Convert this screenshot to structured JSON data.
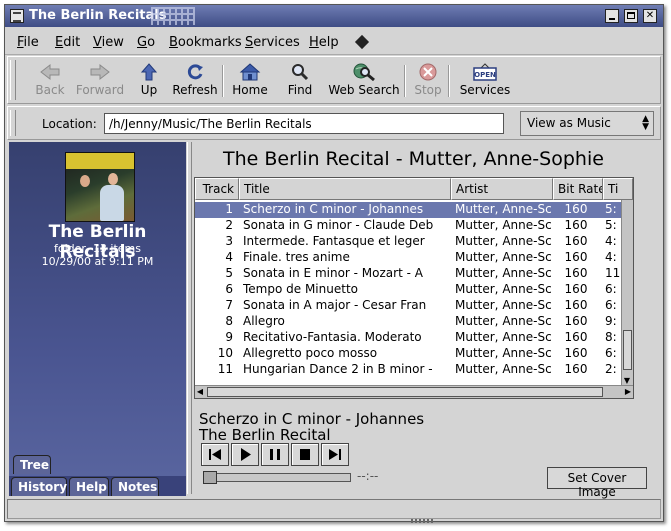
{
  "window": {
    "title": "The Berlin Recitals",
    "controls": [
      "minimize",
      "maximize",
      "close"
    ]
  },
  "menubar": [
    {
      "label": "File",
      "u": "F",
      "rest": "ile"
    },
    {
      "label": "Edit",
      "u": "E",
      "rest": "dit"
    },
    {
      "label": "View",
      "u": "V",
      "rest": "iew"
    },
    {
      "label": "Go",
      "u": "G",
      "rest": "o"
    },
    {
      "label": "Bookmarks",
      "u": "B",
      "rest": "ookmarks"
    },
    {
      "label": "Services",
      "u": "S",
      "rest": "ervices"
    },
    {
      "label": "Help",
      "u": "H",
      "rest": "elp"
    }
  ],
  "toolbar": {
    "back": "Back",
    "forward": "Forward",
    "up": "Up",
    "refresh": "Refresh",
    "home": "Home",
    "find": "Find",
    "web_search": "Web Search",
    "stop": "Stop",
    "services": "Services",
    "services_badge": "OPEN"
  },
  "location": {
    "label": "Location:",
    "value": "/h/Jenny/Music/The Berlin Recitals",
    "view_as": "View as Music"
  },
  "sidebar": {
    "title": "The Berlin Recitals",
    "subtitle": "folder, 13 items",
    "date": "10/29/00 at 9:11 PM",
    "tabs": [
      "Tree",
      "History",
      "Help",
      "Notes"
    ]
  },
  "main": {
    "title": "The Berlin Recital - Mutter, Anne-Sophie",
    "columns": [
      "Track",
      "Title",
      "Artist",
      "Bit Rate",
      "Ti"
    ],
    "tracks": [
      {
        "track": "1",
        "title": "Scherzo in C minor - Johannes",
        "artist": "Mutter, Anne-Sc",
        "bitrate": "160",
        "time": "5:",
        "selected": true
      },
      {
        "track": "2",
        "title": "Sonata in G minor - Claude Deb",
        "artist": "Mutter, Anne-Sc",
        "bitrate": "160",
        "time": "5:",
        "selected": false
      },
      {
        "track": "3",
        "title": "Intermede. Fantasque et leger",
        "artist": "Mutter, Anne-Sc",
        "bitrate": "160",
        "time": "4:",
        "selected": false
      },
      {
        "track": "4",
        "title": "Finale. tres anime",
        "artist": "Mutter, Anne-Sc",
        "bitrate": "160",
        "time": "4:",
        "selected": false
      },
      {
        "track": "5",
        "title": "Sonata in E minor - Mozart - A",
        "artist": "Mutter, Anne-Sc",
        "bitrate": "160",
        "time": "11:",
        "selected": false
      },
      {
        "track": "6",
        "title": "Tempo de Minuetto",
        "artist": "Mutter, Anne-Sc",
        "bitrate": "160",
        "time": "6:",
        "selected": false
      },
      {
        "track": "7",
        "title": "Sonata in A major - Cesar Fran",
        "artist": "Mutter, Anne-Sc",
        "bitrate": "160",
        "time": "6:",
        "selected": false
      },
      {
        "track": "8",
        "title": "Allegro",
        "artist": "Mutter, Anne-Sc",
        "bitrate": "160",
        "time": "9:",
        "selected": false
      },
      {
        "track": "9",
        "title": "Recitativo-Fantasia. Moderato",
        "artist": "Mutter, Anne-Sc",
        "bitrate": "160",
        "time": "8:",
        "selected": false
      },
      {
        "track": "10",
        "title": "Allegretto poco mosso",
        "artist": "Mutter, Anne-Sc",
        "bitrate": "160",
        "time": "6:",
        "selected": false
      },
      {
        "track": "11",
        "title": "Hungarian Dance 2 in B minor -",
        "artist": "Mutter, Anne-Sc",
        "bitrate": "160",
        "time": "2:",
        "selected": false
      }
    ]
  },
  "now_playing": {
    "track_title": "Scherzo in C minor - Johannes",
    "album": "The Berlin Recital",
    "time": "--:--",
    "set_cover": "Set Cover Image"
  },
  "colors": {
    "selection": "#6b78ae",
    "sidebar": "#4a5591",
    "titlebar": "#3e4c85"
  }
}
